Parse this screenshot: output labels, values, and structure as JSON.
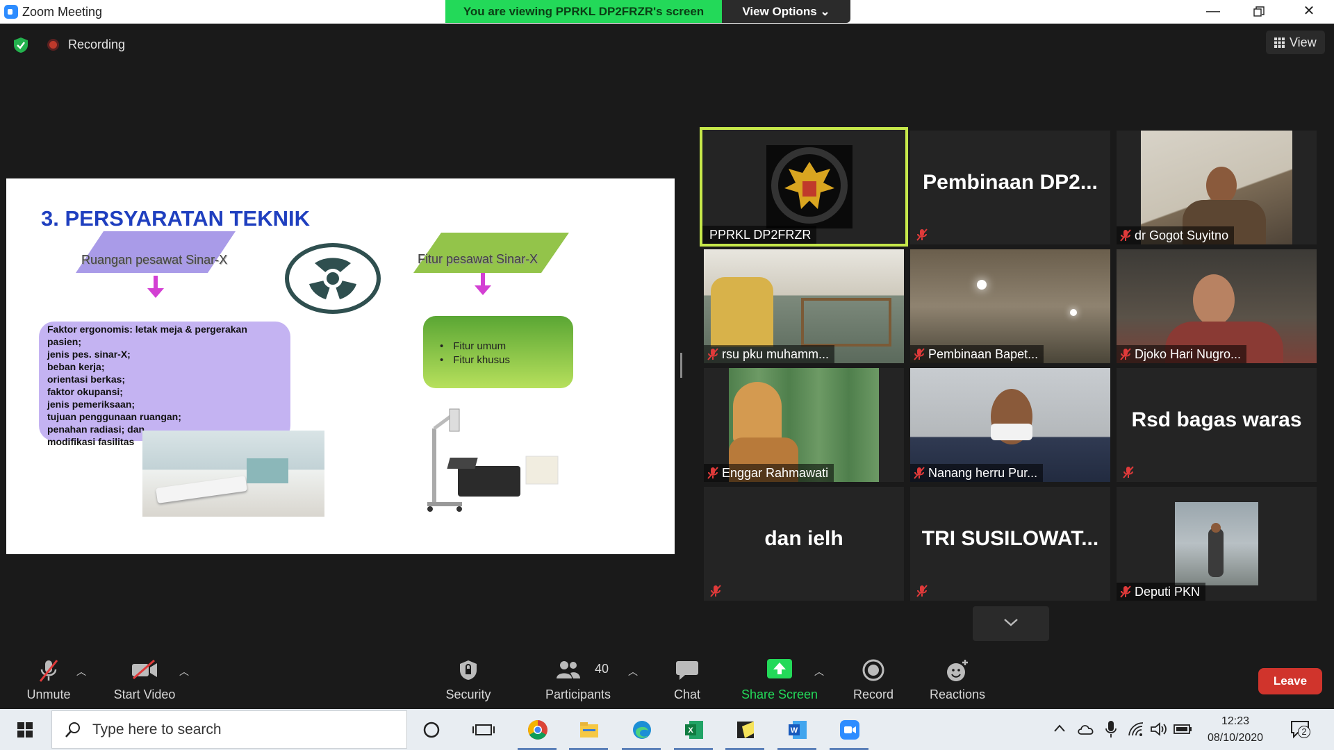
{
  "window": {
    "title": "Zoom Meeting",
    "minimize_icon": "minimize-icon",
    "restore_icon": "restore-icon",
    "close_icon": "close-icon"
  },
  "share_banner": {
    "viewing_text": "You are viewing PPRKL DP2FRZR's screen",
    "view_options_label": "View Options"
  },
  "meeting_bar": {
    "recording_label": "Recording",
    "view_label": "View"
  },
  "slide": {
    "title": "3. PERSYARATAN TEKNIK",
    "left_heading": "Ruangan pesawat Sinar-X",
    "right_heading": "Fitur pesawat Sinar-X",
    "factors": [
      "Faktor ergonomis: letak meja & pergerakan",
      "pasien;",
      "jenis pes. sinar-X;",
      "beban kerja;",
      "orientasi berkas;",
      "faktor okupansi;",
      "jenis pemeriksaan;",
      "tujuan penggunaan ruangan;",
      "penahan radiasi; dan",
      "modifikasi fasilitas"
    ],
    "features": [
      "Fitur umum",
      "Fitur khusus"
    ]
  },
  "participants_grid": [
    {
      "name": "PPRKL DP2FRZR",
      "type": "logo",
      "active": true,
      "muted": false
    },
    {
      "name": "Pembinaan DP2...",
      "type": "name",
      "muted": true,
      "show_label": false
    },
    {
      "name": "dr Gogot Suyitno",
      "type": "video",
      "muted": true
    },
    {
      "name": "rsu pku muhamm...",
      "type": "video",
      "muted": true
    },
    {
      "name": "Pembinaan Bapet...",
      "type": "video",
      "muted": true
    },
    {
      "name": "Djoko Hari Nugro...",
      "type": "video",
      "muted": true
    },
    {
      "name": "Enggar Rahmawati",
      "type": "video",
      "muted": true
    },
    {
      "name": "Nanang herru Pur...",
      "type": "video",
      "muted": true
    },
    {
      "name": "Rsd bagas waras",
      "type": "name",
      "muted": true,
      "show_label": false
    },
    {
      "name": "dan ielh",
      "type": "name",
      "muted": true,
      "show_label": false
    },
    {
      "name": "TRI SUSILOWAT...",
      "type": "name",
      "muted": true,
      "show_label": false
    },
    {
      "name": "Deputi PKN",
      "type": "video",
      "muted": true
    }
  ],
  "toolbar": {
    "unmute_label": "Unmute",
    "start_video_label": "Start Video",
    "security_label": "Security",
    "participants_label": "Participants",
    "participants_count": "40",
    "chat_label": "Chat",
    "share_screen_label": "Share Screen",
    "record_label": "Record",
    "reactions_label": "Reactions",
    "leave_label": "Leave",
    "share_color": "#23d959",
    "leave_color": "#d0342c"
  },
  "taskbar": {
    "search_placeholder": "Type here to search",
    "time": "12:23",
    "date": "08/10/2020",
    "notification_count": "2",
    "apps": [
      "chrome-icon",
      "file-explorer-icon",
      "edge-icon",
      "excel-icon",
      "sticky-notes-icon",
      "word-icon",
      "zoom-icon"
    ]
  }
}
